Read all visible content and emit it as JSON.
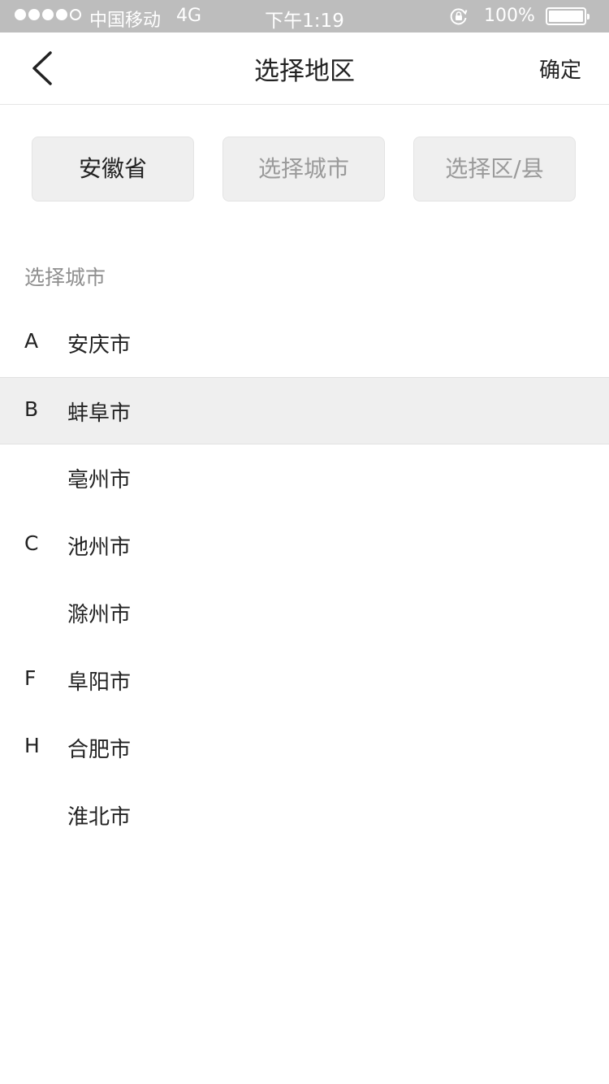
{
  "status_bar": {
    "carrier": "中国移动",
    "network": "4G",
    "time": "下午1:19",
    "battery": "100%"
  },
  "nav": {
    "title": "选择地区",
    "confirm_label": "确定"
  },
  "tabs": [
    {
      "label": "安徽省",
      "state": "active"
    },
    {
      "label": "选择城市",
      "state": "inactive"
    },
    {
      "label": "选择区/县",
      "state": "inactive"
    }
  ],
  "section_label": "选择城市",
  "cities": [
    {
      "letter": "A",
      "name": "安庆市",
      "highlighted": false
    },
    {
      "letter": "B",
      "name": "蚌阜市",
      "highlighted": true
    },
    {
      "letter": "",
      "name": "亳州市",
      "highlighted": false
    },
    {
      "letter": "C",
      "name": "池州市",
      "highlighted": false
    },
    {
      "letter": "",
      "name": "滁州市",
      "highlighted": false
    },
    {
      "letter": "F",
      "name": "阜阳市",
      "highlighted": false
    },
    {
      "letter": "H",
      "name": "合肥市",
      "highlighted": false
    },
    {
      "letter": "",
      "name": "淮北市",
      "highlighted": false
    }
  ],
  "colors": {
    "status_bar_bg": "#bdbdbd",
    "highlight_bg": "#efefef",
    "inactive_text": "#9a9a9a"
  }
}
